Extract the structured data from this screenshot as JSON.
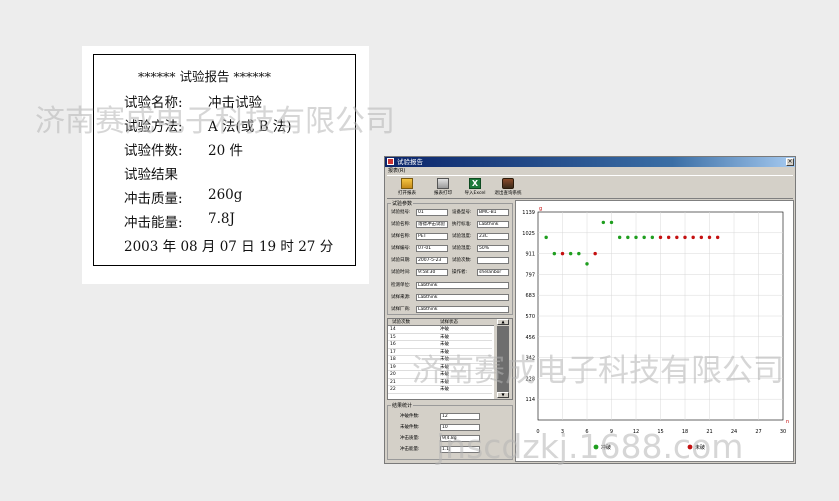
{
  "report": {
    "title": "****** 试验报告 ******",
    "name_label": "试验名称:",
    "name_value": "冲击试验",
    "method_label": "试验方法:",
    "method_value": "A 法(或 B 法)",
    "count_label": "试验件数:",
    "count_value": "20 件",
    "result_label": "试验结果",
    "mass_label": "冲击质量:",
    "mass_value": "260g",
    "energy_label": "冲击能量:",
    "energy_value": "7.8J",
    "datetime": "2003 年 08 月 07 日 19 时 27 分"
  },
  "watermarks": {
    "company": "济南赛成电子科技有限公司",
    "company2": "济南赛成电子科技有限公司",
    "url": "jnscdzkj.1688.com"
  },
  "window": {
    "title": "试验报告",
    "close_glyph": "×",
    "menu": "报表(R)",
    "toolbar": [
      {
        "label": "打开报表",
        "icon": "folder-icon"
      },
      {
        "label": "报表打印",
        "icon": "printer-icon"
      },
      {
        "label": "导入Excel",
        "icon": "excel-icon"
      },
      {
        "label": "退出查询系统",
        "icon": "exit-icon"
      }
    ],
    "excel_glyph": "X"
  },
  "params": {
    "group_title": "试验参数",
    "f1_label": "试验批号:",
    "f1_value": "01",
    "f2_label": "设备型号:",
    "f2_value": "BMC-B1",
    "f3_label": "试验名称:",
    "f3_value": "落镖冲击试验",
    "f4_label": "执行标准:",
    "f4_value": "Labthink",
    "f5_label": "试样名称:",
    "f5_value": "PET",
    "f6_label": "试验温度:",
    "f6_value": "23C",
    "f7_label": "试样编号:",
    "f7_value": "07-01",
    "f8_label": "试验湿度:",
    "f8_value": "50%",
    "f9_label": "试验日期:",
    "f9_value": "2007-5-23",
    "f10_label": "试验次数:",
    "f10_value": "",
    "f11_label": "试验时间:",
    "f11_value": "9:58:30",
    "f12_label": "操作者:",
    "f12_value": "shelanbor",
    "f13_label": "检测单位:",
    "f13_value": "Labthink",
    "f14_label": "试样来源:",
    "f14_value": "Labthink",
    "f15_label": "试样厂商:",
    "f15_value": "Labthink"
  },
  "table": {
    "col1": "试验次数",
    "col2": "试样状态",
    "rows": [
      {
        "n": "14",
        "s": "冲破"
      },
      {
        "n": "15",
        "s": "未破"
      },
      {
        "n": "16",
        "s": "未破"
      },
      {
        "n": "17",
        "s": "未破"
      },
      {
        "n": "18",
        "s": "未破"
      },
      {
        "n": "19",
        "s": "未破"
      },
      {
        "n": "20",
        "s": "未破"
      },
      {
        "n": "21",
        "s": "未破"
      },
      {
        "n": "22",
        "s": "未破"
      }
    ],
    "up_glyph": "▲",
    "down_glyph": "▼"
  },
  "stats": {
    "group_title": "结果统计",
    "broken_label": "冲破件数:",
    "broken_value": "12",
    "unbroken_label": "未破件数:",
    "unbroken_value": "10",
    "mass_label": "冲击质量:",
    "mass_value": "9(4.8g",
    "energy_label": "冲击能量:",
    "energy_value": "1.1J"
  },
  "colors": {
    "broken": "#1f9e1f",
    "unbroken": "#c41010",
    "axis_unit": "#c00000"
  },
  "chart_data": {
    "type": "scatter",
    "ylabel": "g",
    "xlabel": "n",
    "yticks": [
      "1139",
      "1025",
      "911",
      "797",
      "683",
      "570",
      "456",
      "342",
      "228",
      "114"
    ],
    "xticks": [
      "0",
      "3",
      "6",
      "9",
      "12",
      "15",
      "18",
      "21",
      "24",
      "27",
      "30"
    ],
    "xlim": [
      0,
      30
    ],
    "ylim": [
      0,
      1139
    ],
    "grid": true,
    "legend": [
      "冲破",
      "未破"
    ],
    "legend_position": "bottom",
    "points": [
      {
        "x": 1,
        "y": 1000,
        "s": "broken"
      },
      {
        "x": 2,
        "y": 911,
        "s": "broken"
      },
      {
        "x": 3,
        "y": 911,
        "s": "unbroken"
      },
      {
        "x": 4,
        "y": 911,
        "s": "broken"
      },
      {
        "x": 5,
        "y": 911,
        "s": "broken"
      },
      {
        "x": 6,
        "y": 855,
        "s": "broken"
      },
      {
        "x": 7,
        "y": 911,
        "s": "unbroken"
      },
      {
        "x": 8,
        "y": 1082,
        "s": "broken"
      },
      {
        "x": 9,
        "y": 1082,
        "s": "broken"
      },
      {
        "x": 10,
        "y": 1000,
        "s": "broken"
      },
      {
        "x": 11,
        "y": 1000,
        "s": "broken"
      },
      {
        "x": 12,
        "y": 1000,
        "s": "broken"
      },
      {
        "x": 13,
        "y": 1000,
        "s": "broken"
      },
      {
        "x": 14,
        "y": 1000,
        "s": "broken"
      },
      {
        "x": 15,
        "y": 1000,
        "s": "unbroken"
      },
      {
        "x": 16,
        "y": 1000,
        "s": "unbroken"
      },
      {
        "x": 17,
        "y": 1000,
        "s": "unbroken"
      },
      {
        "x": 18,
        "y": 1000,
        "s": "unbroken"
      },
      {
        "x": 19,
        "y": 1000,
        "s": "unbroken"
      },
      {
        "x": 20,
        "y": 1000,
        "s": "unbroken"
      },
      {
        "x": 21,
        "y": 1000,
        "s": "unbroken"
      },
      {
        "x": 22,
        "y": 1000,
        "s": "unbroken"
      }
    ]
  }
}
